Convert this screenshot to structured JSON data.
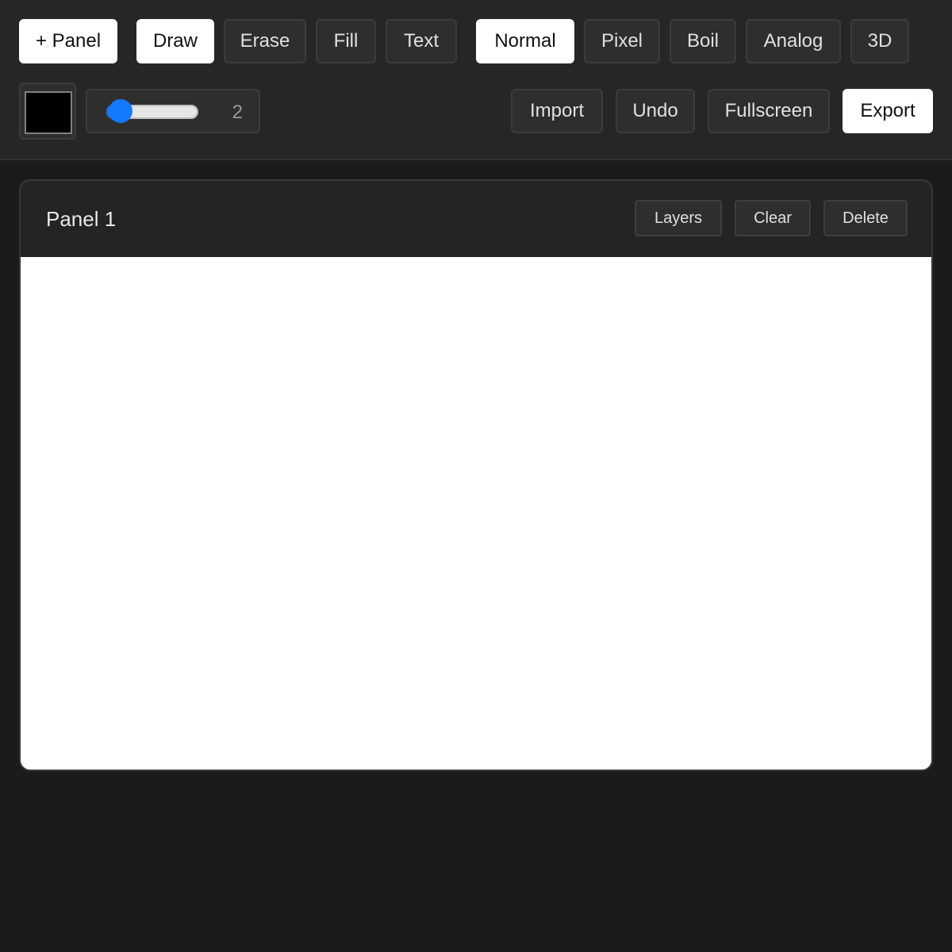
{
  "toolbar": {
    "add_panel_label": "+ Panel",
    "tools": [
      {
        "label": "Draw",
        "active": true
      },
      {
        "label": "Erase",
        "active": false
      },
      {
        "label": "Fill",
        "active": false
      },
      {
        "label": "Text",
        "active": false
      }
    ],
    "modes": [
      {
        "label": "Normal",
        "active": true
      },
      {
        "label": "Pixel",
        "active": false
      },
      {
        "label": "Boil",
        "active": false
      },
      {
        "label": "Analog",
        "active": false
      },
      {
        "label": "3D",
        "active": false
      }
    ],
    "brush_color": "#000000",
    "brush_size": {
      "value": "2",
      "min": 1,
      "max": 50
    },
    "actions": {
      "import_label": "Import",
      "undo_label": "Undo",
      "fullscreen_label": "Fullscreen",
      "export_label": "Export"
    }
  },
  "panel": {
    "title": "Panel 1",
    "layers_label": "Layers",
    "clear_label": "Clear",
    "delete_label": "Delete"
  },
  "colors": {
    "accent": "#1479ff",
    "background": "#1b1b1b",
    "toolbar": "#262626",
    "canvas": "#ffffff"
  }
}
